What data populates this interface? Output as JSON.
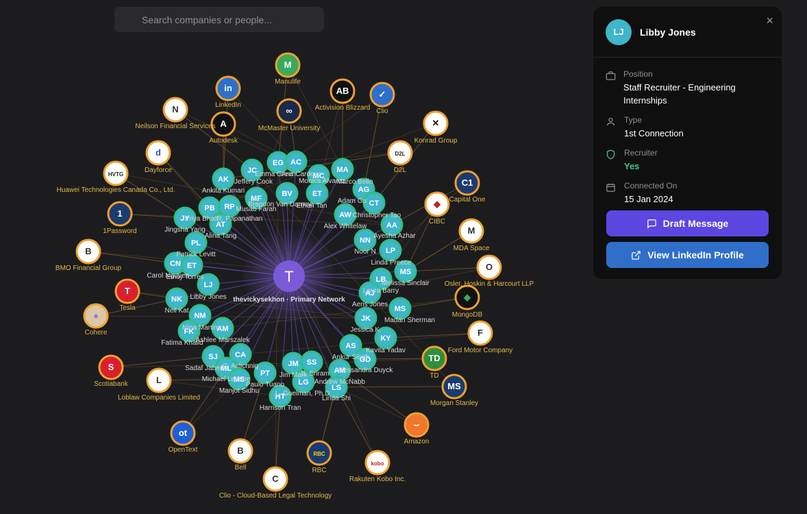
{
  "search": {
    "placeholder": "Search companies or people..."
  },
  "center": {
    "initial": "T",
    "label": "thevickysekhon · Primary Network"
  },
  "colors": {
    "background": "#1c1c1e",
    "person_fill": "#3fb6ca",
    "person_ring": "#2fbf82",
    "company_ring": "#f0a030",
    "center": "#7b5ad8",
    "edge": "#6a4fc4",
    "company_edge": "#7a5a2a",
    "draft": "#5b47e0",
    "linkedin": "#2f6fc9",
    "recruiter_yes": "#3ec792"
  },
  "people": [
    {
      "initials": "AK",
      "name": "Ankita Kumari"
    },
    {
      "initials": "JC",
      "name": "Jeffery Cook"
    },
    {
      "initials": "EG",
      "name": "Emma Green"
    },
    {
      "initials": "AC",
      "name": "Ana Cardoso"
    },
    {
      "initials": "MC",
      "name": "Monica Alvarez"
    },
    {
      "initials": "MA",
      "name": "Marco Bello"
    },
    {
      "initials": "MF",
      "name": "Musab Farah"
    },
    {
      "initials": "BV",
      "name": "Brandon Van Damme"
    },
    {
      "initials": "ET",
      "name": "Ethan Tan"
    },
    {
      "initials": "AG",
      "name": "Adam Gu"
    },
    {
      "initials": "CT",
      "name": "Christopher Tao"
    },
    {
      "initials": "PB",
      "name": "Priya Bhatt"
    },
    {
      "initials": "RP",
      "name": "R. Papanathan"
    },
    {
      "initials": "JY",
      "name": "Jingsha Yang"
    },
    {
      "initials": "AT",
      "name": "Alina Tang"
    },
    {
      "initials": "AW",
      "name": "Alex Whitelaw"
    },
    {
      "initials": "AA",
      "name": "Ayesha Azhar"
    },
    {
      "initials": "PL",
      "name": "Patrick Levitt"
    },
    {
      "initials": "NN",
      "name": "Noor N"
    },
    {
      "initials": "LP",
      "name": "Linda Preece"
    },
    {
      "initials": "CN",
      "name": "Carol Nguyen"
    },
    {
      "initials": "ET",
      "name": "Emily Torres"
    },
    {
      "initials": "MS",
      "name": "Melissa Sinclair"
    },
    {
      "initials": "LB",
      "name": "Laura Barry"
    },
    {
      "initials": "LJ",
      "name": "Libby Jones"
    },
    {
      "initials": "AJ",
      "name": "Aeris Jones"
    },
    {
      "initials": "NK",
      "name": "Neil Kat"
    },
    {
      "initials": "MS",
      "name": "Madan Sherman"
    },
    {
      "initials": "NM",
      "name": "Nina Martin"
    },
    {
      "initials": "JK",
      "name": "Jessica K."
    },
    {
      "initials": "AM",
      "name": "Ashlee Marszalek"
    },
    {
      "initials": "FK",
      "name": "Fatima Khalid"
    },
    {
      "initials": "KY",
      "name": "Kavita Yadav"
    },
    {
      "initials": "AS",
      "name": "Ankur Singh"
    },
    {
      "initials": "SJ",
      "name": "Sadaf Jabeen"
    },
    {
      "initials": "CA",
      "name": "C. Aslichnig"
    },
    {
      "initials": "GD",
      "name": "Alessandra Duyck"
    },
    {
      "initials": "JM",
      "name": "Jim Mark"
    },
    {
      "initials": "SS",
      "name": "S. Sriram"
    },
    {
      "initials": "ML",
      "name": "Michael Lemme"
    },
    {
      "initials": "PT",
      "name": "Paulo Tuano"
    },
    {
      "initials": "AM",
      "name": "Andrew McNabb"
    },
    {
      "initials": "MS",
      "name": "Manjot Sidhu"
    },
    {
      "initials": "LG",
      "name": "L. Guelman, Ph.D."
    },
    {
      "initials": "LS",
      "name": "Linda Shi"
    },
    {
      "initials": "HT",
      "name": "Harrison Tran"
    }
  ],
  "companies": [
    {
      "name": "Manulife",
      "logo": "M",
      "color": "#3aaa5c",
      "textColor": "#ffffff"
    },
    {
      "name": "LinkedIn",
      "logo": "in",
      "color": "#2f6fc9",
      "textColor": "#ffffff"
    },
    {
      "name": "Activision Blizzard",
      "logo": "AB",
      "color": "#111111",
      "textColor": "#ffffff"
    },
    {
      "name": "Clio",
      "logo": "✓",
      "color": "#2f6fc9",
      "textColor": "#ffffff"
    },
    {
      "name": "Neilson Financial Services",
      "logo": "N",
      "color": "#ffffff",
      "textColor": "#333333"
    },
    {
      "name": "McMaster University",
      "logo": "∞",
      "color": "#1b2a4a",
      "textColor": "#ffffff"
    },
    {
      "name": "Autodesk",
      "logo": "A",
      "color": "#111111",
      "textColor": "#ffffff"
    },
    {
      "name": "Konrad Group",
      "logo": "✕",
      "color": "#ffffff",
      "textColor": "#111111"
    },
    {
      "name": "Dayforce",
      "logo": "d",
      "color": "#ffffff",
      "textColor": "#3b4bd0"
    },
    {
      "name": "D2L",
      "logo": "D2L",
      "color": "#ffffff",
      "textColor": "#222222"
    },
    {
      "name": "Huawei Technologies Canada Co., Ltd.",
      "logo": "HVTG",
      "color": "#ffffff",
      "textColor": "#222222"
    },
    {
      "name": "Capital One",
      "logo": "C1",
      "color": "#1b3b6f",
      "textColor": "#ffffff"
    },
    {
      "name": "CIBC",
      "logo": "◆",
      "color": "#ffffff",
      "textColor": "#c0202e"
    },
    {
      "name": "1Password",
      "logo": "1",
      "color": "#1b3b6f",
      "textColor": "#ffffff"
    },
    {
      "name": "MDA Space",
      "logo": "M",
      "color": "#ffffff",
      "textColor": "#333333"
    },
    {
      "name": "BMO Financial Group",
      "logo": "B",
      "color": "#ffffff",
      "textColor": "#333333"
    },
    {
      "name": "Osler, Hoskin & Harcourt LLP",
      "logo": "O",
      "color": "#ffffff",
      "textColor": "#333333"
    },
    {
      "name": "Tesla",
      "logo": "T",
      "color": "#d8202e",
      "textColor": "#ffffff"
    },
    {
      "name": "MongoDB",
      "logo": "◆",
      "color": "#111111",
      "textColor": "#3aaa5c"
    },
    {
      "name": "Cohere",
      "logo": "●",
      "color": "#d9c7a8",
      "textColor": "#b06ad0"
    },
    {
      "name": "Ford Motor Company",
      "logo": "F",
      "color": "#ffffff",
      "textColor": "#333333"
    },
    {
      "name": "TD",
      "logo": "TD",
      "color": "#2f8f3a",
      "textColor": "#ffffff"
    },
    {
      "name": "Scotiabank",
      "logo": "S",
      "color": "#d8202e",
      "textColor": "#ffffff"
    },
    {
      "name": "Loblaw Companies Limited",
      "logo": "L",
      "color": "#ffffff",
      "textColor": "#333333"
    },
    {
      "name": "Morgan Stanley",
      "logo": "MS",
      "color": "#1b3b6f",
      "textColor": "#ffffff"
    },
    {
      "name": "Amazon",
      "logo": "⌣",
      "color": "#f0772b",
      "textColor": "#ffffff"
    },
    {
      "name": "OpenText",
      "logo": "ot",
      "color": "#1e5fd8",
      "textColor": "#ffffff"
    },
    {
      "name": "Bell",
      "logo": "B",
      "color": "#ffffff",
      "textColor": "#333333"
    },
    {
      "name": "RBC",
      "logo": "RBC",
      "color": "#1b3b6f",
      "textColor": "#ffd200"
    },
    {
      "name": "Rakuten Kobo Inc.",
      "logo": "kobo",
      "color": "#ffffff",
      "textColor": "#c0202e"
    },
    {
      "name": "Clio - Cloud-Based Legal Technology",
      "logo": "C",
      "color": "#ffffff",
      "textColor": "#333333"
    }
  ],
  "panel": {
    "avatar": "LJ",
    "name": "Libby Jones",
    "close": "×",
    "position_label": "Position",
    "position_value": "Staff Recruiter - Engineering Internships",
    "type_label": "Type",
    "type_value": "1st Connection",
    "recruiter_label": "Recruiter",
    "recruiter_value": "Yes",
    "connected_label": "Connected On",
    "connected_value": "15 Jan 2024",
    "draft_button": "Draft Message",
    "linkedin_button": "View LinkedIn Profile"
  }
}
